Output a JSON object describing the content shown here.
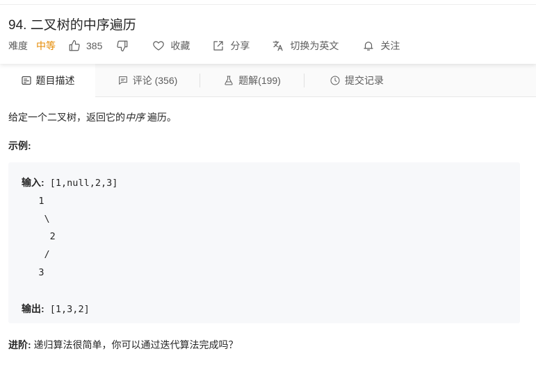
{
  "problem": {
    "title": "94. 二叉树的中序遍历",
    "difficulty_label": "难度",
    "difficulty": "中等",
    "difficulty_color": "#e58a00",
    "likes": "385",
    "favorite_label": "收藏",
    "share_label": "分享",
    "lang_switch_label": "切换为英文",
    "follow_label": "关注"
  },
  "tabs": [
    {
      "label": "题目描述",
      "icon": "description-icon",
      "active": true
    },
    {
      "label": "评论 (356)",
      "icon": "comment-icon",
      "active": false
    },
    {
      "label": "题解(199)",
      "icon": "flask-icon",
      "active": false
    },
    {
      "label": "提交记录",
      "icon": "clock-icon",
      "active": false
    }
  ],
  "content": {
    "desc_prefix": "给定一个二叉树，返回它的",
    "desc_em": "中序",
    "desc_suffix": " 遍历。",
    "example_title": "示例:",
    "input_label": "输入:",
    "input_value": " [1,null,2,3]",
    "tree_lines": [
      "   1",
      "    \\",
      "     2",
      "    /",
      "   3"
    ],
    "output_label": "输出:",
    "output_value": " [1,3,2]",
    "advanced_label": "进阶:",
    "advanced_text": " 递归算法很简单，你可以通过迭代算法完成吗？"
  }
}
